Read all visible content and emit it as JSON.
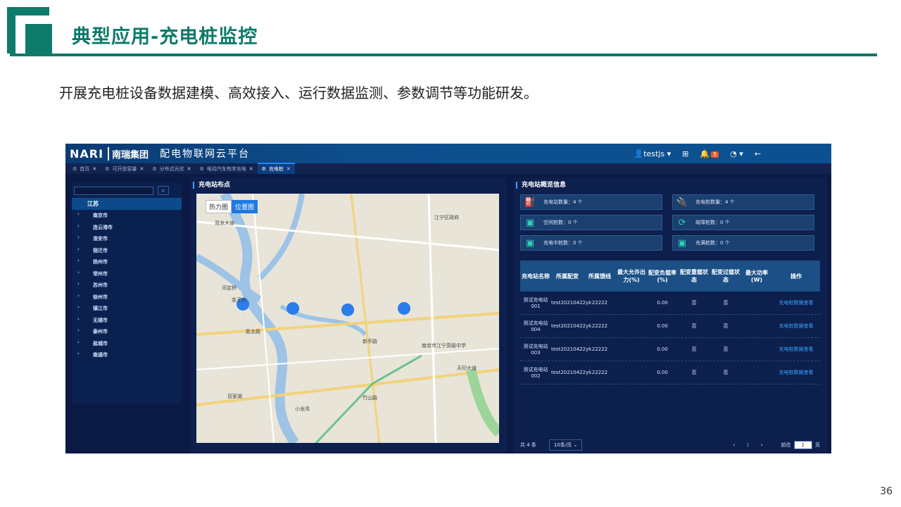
{
  "slide": {
    "title": "典型应用-充电桩监控",
    "subtitle": "开展充电桩设备数据建模、高效接入、运行数据监测、参数调节等功能研发。",
    "page_number": "36"
  },
  "app": {
    "brand": "NARI",
    "brand_cn": "南瑞集团",
    "platform_title": "配电物联网云平台",
    "user": "testjs",
    "notification_count": "5",
    "tabs": [
      {
        "label": "首页"
      },
      {
        "label": "可开放容量"
      },
      {
        "label": "分布式光伏"
      },
      {
        "label": "电动汽车有序充电"
      },
      {
        "label": "充电桩"
      }
    ],
    "sidebar": {
      "province": "江苏",
      "cities": [
        "南京市",
        "连云港市",
        "淮安市",
        "宿迁市",
        "扬州市",
        "常州市",
        "苏州市",
        "徐州市",
        "镇江市",
        "无锡市",
        "泰州市",
        "盐城市",
        "南通市"
      ]
    },
    "map_panel": {
      "label": "充电站布点",
      "toggle_heat": "热力图",
      "toggle_location": "位置图",
      "places": [
        "双龙大道",
        "河定桥",
        "金王府",
        "胜太路",
        "百家湖",
        "小龙湾",
        "竹山路",
        "天印大道",
        "南京市江宁高级中学",
        "新亭路",
        "江宁区政府"
      ]
    },
    "overview": {
      "label": "充电站概览信息",
      "stats": [
        {
          "text": "充电站数量：4 个"
        },
        {
          "text": "充电桩数量：4 个"
        },
        {
          "text": "空闲桩数：0 个"
        },
        {
          "text": "故障桩数：0 个"
        },
        {
          "text": "充电中桩数：0 个"
        },
        {
          "text": "充满桩数：0 个"
        }
      ]
    },
    "table": {
      "headers": [
        "充电站名称",
        "所属配变",
        "所属馈线",
        "最大允许出力(%)",
        "配变负载率(%)",
        "配变重载状态",
        "配变过载状态",
        "最大功率(W)",
        "操作"
      ],
      "rows": [
        {
          "name": "测试充电站001",
          "transformer": "test20210422yk",
          "feeder": "22222",
          "max_output": "",
          "load_rate": "0.00",
          "heavy": "否",
          "over": "否",
          "max_power": "",
          "action": "充电桩数据查看"
        },
        {
          "name": "测试充电站004",
          "transformer": "test20210422yk",
          "feeder": "22222",
          "max_output": "",
          "load_rate": "0.00",
          "heavy": "否",
          "over": "否",
          "max_power": "",
          "action": "充电桩数据查看"
        },
        {
          "name": "测试充电站003",
          "transformer": "test20210422yk",
          "feeder": "22222",
          "max_output": "",
          "load_rate": "0.00",
          "heavy": "否",
          "over": "否",
          "max_power": "",
          "action": "充电桩数据查看"
        },
        {
          "name": "测试充电站002",
          "transformer": "test20210422yk",
          "feeder": "22222",
          "max_output": "",
          "load_rate": "0.00",
          "heavy": "否",
          "over": "否",
          "max_power": "",
          "action": "充电桩数据查看"
        }
      ]
    },
    "pager": {
      "total": "共 4 条",
      "page_size": "10条/页",
      "prev": "‹",
      "current": "1",
      "next": "›",
      "goto_prefix": "前往",
      "goto_value": "1",
      "goto_suffix": "页"
    }
  },
  "colors": {
    "accent": "#0e7a6a",
    "app_bg": "#0b1a45",
    "link": "#3ca3ff"
  }
}
